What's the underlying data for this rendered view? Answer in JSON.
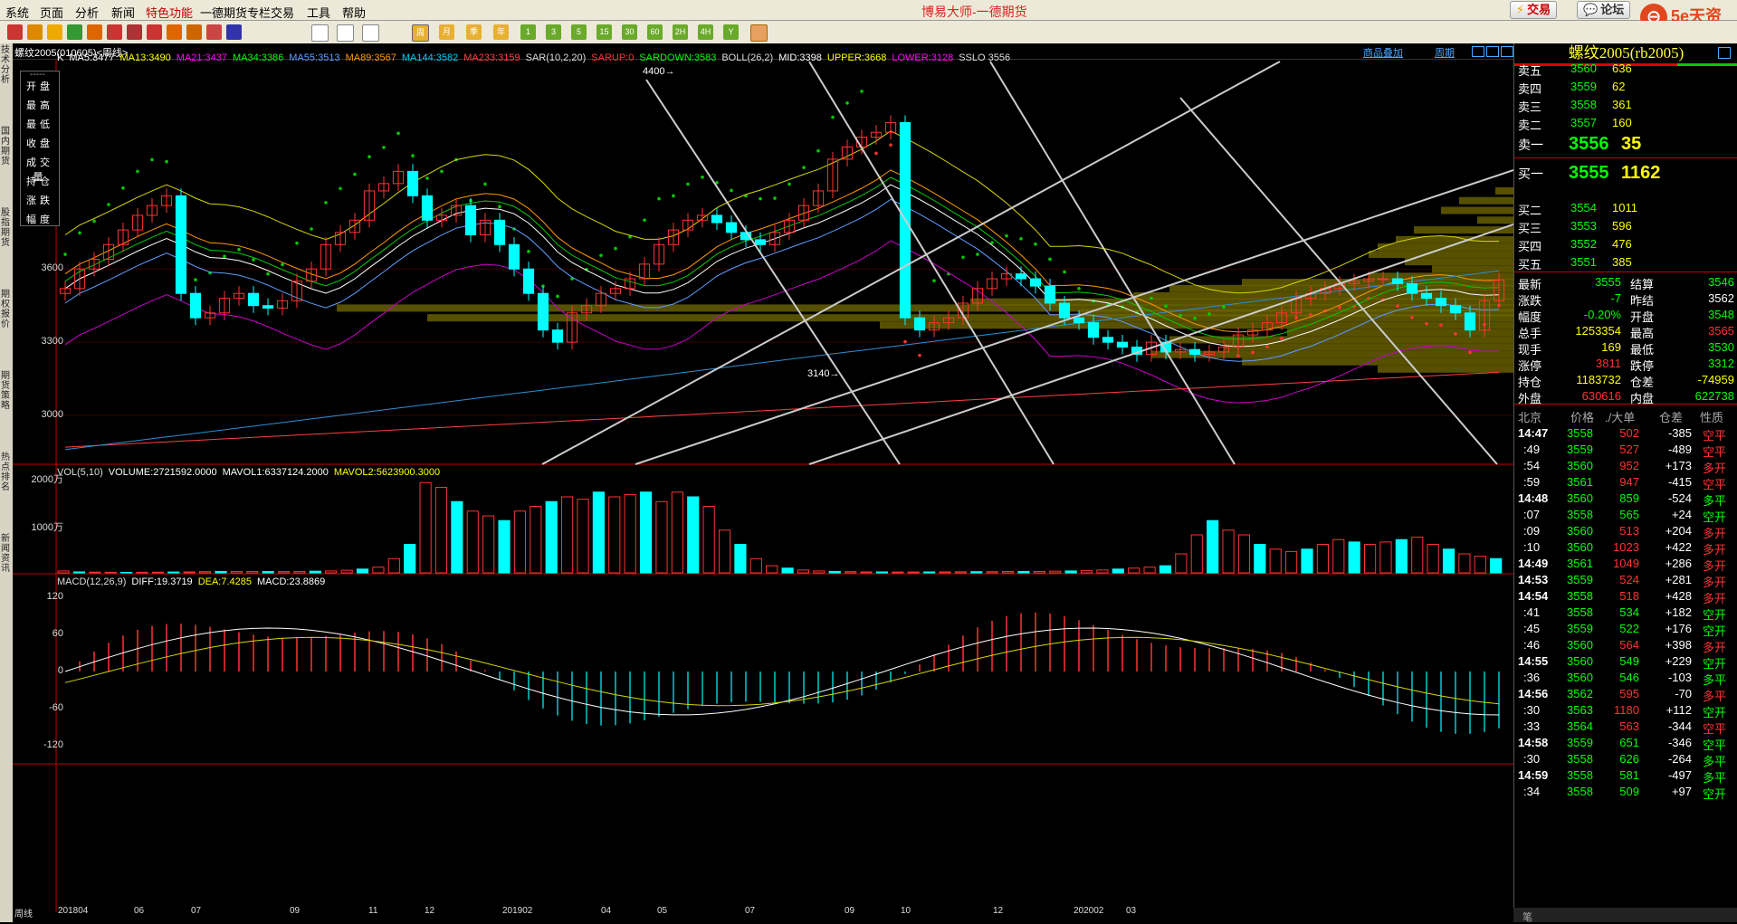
{
  "menu": {
    "items": [
      {
        "label": "系统",
        "red": false
      },
      {
        "label": "页面",
        "red": false
      },
      {
        "label": "分析",
        "red": false
      },
      {
        "label": "新闻",
        "red": false
      },
      {
        "label": "特色功能",
        "red": true
      },
      {
        "label": "一德期货专栏",
        "red": false
      },
      {
        "label": "交易",
        "red": false
      },
      {
        "label": "工具",
        "red": false
      },
      {
        "label": "帮助",
        "red": false
      }
    ],
    "app_title": "博易大师-一德期货",
    "trade_button": "交易",
    "forum_button": "论坛",
    "logo_text": "5e天资",
    "logo_url": "setz.com"
  },
  "toolbar": {
    "period_buttons": [
      "1",
      "3",
      "5",
      "15",
      "30",
      "60",
      "2H",
      "4H",
      "Y"
    ]
  },
  "left_tabs": [
    "技术分析",
    "国内期货",
    "股指期货",
    "期权报价",
    "期货策略",
    "热点排名",
    "新闻资讯"
  ],
  "chart": {
    "tab_name": "螺纹2005(010605)<周线>",
    "right_tabs": [
      "商品叠加",
      "周期"
    ],
    "main_legend": [
      {
        "text": "K",
        "color": "#ffffff"
      },
      {
        "text": "MA5:3477",
        "color": "#ffffff"
      },
      {
        "text": "MA13:3490",
        "color": "#ffff00"
      },
      {
        "text": "MA21:3437",
        "color": "#ff00ff"
      },
      {
        "text": "MA34:3386",
        "color": "#00ff00"
      },
      {
        "text": "MA55:3513",
        "color": "#5f9fff"
      },
      {
        "text": "MA89:3567",
        "color": "#ff9900"
      },
      {
        "text": "MA144:3582",
        "color": "#00ccff"
      },
      {
        "text": "MA233:3159",
        "color": "#ff4040"
      },
      {
        "text": "SAR(10,2,20)",
        "color": "#dddddd"
      },
      {
        "text": "SARUP:0",
        "color": "#ff3333"
      },
      {
        "text": "SARDOWN:3583",
        "color": "#00ff00"
      },
      {
        "text": "BOLL(26,2)",
        "color": "#dddddd"
      },
      {
        "text": "MID:3398",
        "color": "#ffffff"
      },
      {
        "text": "UPPER:3668",
        "color": "#ffff00"
      },
      {
        "text": "LOWER:3128",
        "color": "#ff00ff"
      },
      {
        "text": "SSLO 3556",
        "color": "#dddddd"
      }
    ],
    "vol_legend": [
      {
        "text": "VOL(5,10)",
        "color": "#dddddd"
      },
      {
        "text": "VOLUME:2721592.0000",
        "color": "#ffffff"
      },
      {
        "text": "MAVOL1:6337124.2000",
        "color": "#ffffff"
      },
      {
        "text": "MAVOL2:5623900.3000",
        "color": "#ffff00"
      }
    ],
    "macd_legend": [
      {
        "text": "MACD(12,26,9)",
        "color": "#dddddd"
      },
      {
        "text": "DIFF:19.3719",
        "color": "#ffffff"
      },
      {
        "text": "DEA:7.4285",
        "color": "#ffff00"
      },
      {
        "text": "MACD:23.8869",
        "color": "#ffffff"
      }
    ],
    "price_ticks": [
      "3600",
      "3300",
      "3000"
    ],
    "vol_ticks": [
      "2000万",
      "1000万"
    ],
    "macd_ticks": [
      "120",
      "60",
      "0",
      "-60",
      "-120"
    ],
    "x_ticks": [
      "周线",
      "201804",
      "06",
      "07",
      "09",
      "11",
      "12",
      "201902",
      "04",
      "05",
      "07",
      "09",
      "10",
      "12",
      "202002",
      "03"
    ],
    "high_label": "4400",
    "low_label": "3140"
  },
  "chart_data": {
    "type": "candlestick",
    "title": "螺纹2005(010605)<周线>",
    "ylim": [
      2800,
      4450
    ],
    "highest": 4400,
    "lowest": 3140,
    "x_axis_labels": [
      "201804",
      "06",
      "07",
      "09",
      "11",
      "12",
      "201902",
      "04",
      "05",
      "07",
      "09",
      "10",
      "12",
      "202002",
      "03"
    ],
    "close": [
      3520,
      3600,
      3640,
      3700,
      3760,
      3820,
      3860,
      3900,
      3500,
      3400,
      3420,
      3480,
      3500,
      3450,
      3440,
      3470,
      3550,
      3600,
      3700,
      3750,
      3800,
      3920,
      3950,
      4000,
      3900,
      3800,
      3820,
      3860,
      3740,
      3800,
      3700,
      3600,
      3500,
      3350,
      3300,
      3420,
      3450,
      3500,
      3520,
      3560,
      3620,
      3700,
      3760,
      3800,
      3820,
      3790,
      3750,
      3720,
      3700,
      3750,
      3800,
      3860,
      3920,
      4050,
      4100,
      4140,
      4160,
      4200,
      3400,
      3350,
      3380,
      3400,
      3460,
      3520,
      3560,
      3580,
      3560,
      3530,
      3460,
      3400,
      3380,
      3320,
      3300,
      3280,
      3250,
      3300,
      3260,
      3270,
      3250,
      3260,
      3280,
      3330,
      3350,
      3380,
      3420,
      3480,
      3500,
      3520,
      3540,
      3550,
      3560,
      3560,
      3540,
      3500,
      3480,
      3450,
      3420,
      3350,
      3470,
      3555
    ],
    "volume_wan": [
      40,
      20,
      15,
      12,
      10,
      12,
      14,
      18,
      20,
      25,
      30,
      30,
      30,
      28,
      26,
      30,
      35,
      40,
      55,
      80,
      120,
      300,
      600,
      1900,
      1800,
      1500,
      1300,
      1200,
      1100,
      1300,
      1400,
      1500,
      1600,
      1550,
      1700,
      1600,
      1650,
      1700,
      1500,
      1700,
      1600,
      1400,
      900,
      600,
      300,
      150,
      100,
      60,
      40,
      30,
      25,
      20,
      20,
      18,
      18,
      20,
      20,
      22,
      25,
      25,
      28,
      30,
      30,
      35,
      40,
      50,
      60,
      80,
      100,
      120,
      150,
      400,
      800,
      1100,
      900,
      800,
      600,
      500,
      450,
      500,
      600,
      700,
      650,
      600,
      650,
      700,
      750,
      600,
      500,
      400,
      350,
      300
    ],
    "macd_hist_range": [
      -140,
      130
    ],
    "vol_ylim": [
      0,
      2000
    ],
    "macd_ylim": [
      -140,
      140
    ]
  },
  "quote": {
    "title": "螺纹2005(rb2005)",
    "asks": [
      {
        "label": "卖五",
        "price": "3560",
        "vol": "636"
      },
      {
        "label": "卖四",
        "price": "3559",
        "vol": "62"
      },
      {
        "label": "卖三",
        "price": "3558",
        "vol": "361"
      },
      {
        "label": "卖二",
        "price": "3557",
        "vol": "160"
      },
      {
        "label": "卖一",
        "price": "3556",
        "vol": "35"
      }
    ],
    "bids": [
      {
        "label": "买一",
        "price": "3555",
        "vol": "1162"
      },
      {
        "label": "买二",
        "price": "3554",
        "vol": "1011"
      },
      {
        "label": "买三",
        "price": "3553",
        "vol": "596"
      },
      {
        "label": "买四",
        "price": "3552",
        "vol": "476"
      },
      {
        "label": "买五",
        "price": "3551",
        "vol": "385"
      }
    ],
    "stats": [
      {
        "l1": "最新",
        "v1": "3555",
        "c1": "#00ff00",
        "l2": "结算",
        "v2": "3546",
        "c2": "#00ff00"
      },
      {
        "l1": "涨跌",
        "v1": "-7",
        "c1": "#00ff00",
        "l2": "昨结",
        "v2": "3562",
        "c2": "#ffffff"
      },
      {
        "l1": "幅度",
        "v1": "-0.20%",
        "c1": "#00ff00",
        "l2": "开盘",
        "v2": "3548",
        "c2": "#00ff00"
      },
      {
        "l1": "总手",
        "v1": "1253354",
        "c1": "#ffff00",
        "l2": "最高",
        "v2": "3565",
        "c2": "#ff3333"
      },
      {
        "l1": "现手",
        "v1": "169",
        "c1": "#ffff00",
        "l2": "最低",
        "v2": "3530",
        "c2": "#00ff00"
      },
      {
        "l1": "涨停",
        "v1": "3811",
        "c1": "#ff3333",
        "l2": "跌停",
        "v2": "3312",
        "c2": "#00ff00"
      },
      {
        "l1": "持仓",
        "v1": "1183732",
        "c1": "#ffff00",
        "l2": "仓差",
        "v2": "-74959",
        "c2": "#ffff00"
      },
      {
        "l1": "外盘",
        "v1": "630616",
        "c1": "#ff3333",
        "l2": "内盘",
        "v2": "622738",
        "c2": "#00ff00"
      }
    ],
    "tick_header": {
      "time": "北京",
      "price": "价格",
      "vol": "./大单",
      "oi": "仓差",
      "nature": "性质"
    },
    "ticks": [
      {
        "time": "14:47",
        "price": "3558",
        "vol": "502",
        "oi": "-385",
        "nature": "空平",
        "vc": "#ff3333",
        "nc": "#ff3333"
      },
      {
        "time": ":49",
        "price": "3559",
        "vol": "527",
        "oi": "-489",
        "nature": "空平",
        "vc": "#ff3333",
        "nc": "#ff3333"
      },
      {
        "time": ":54",
        "price": "3560",
        "vol": "952",
        "oi": "+173",
        "nature": "多开",
        "vc": "#ff3333",
        "nc": "#ff3333"
      },
      {
        "time": ":59",
        "price": "3561",
        "vol": "947",
        "oi": "-415",
        "nature": "空平",
        "vc": "#ff3333",
        "nc": "#ff3333"
      },
      {
        "time": "14:48",
        "price": "3560",
        "vol": "859",
        "oi": "-524",
        "nature": "多平",
        "vc": "#00ff00",
        "nc": "#00ff00"
      },
      {
        "time": ":07",
        "price": "3558",
        "vol": "565",
        "oi": "+24",
        "nature": "空开",
        "vc": "#00ff00",
        "nc": "#00ff00"
      },
      {
        "time": ":09",
        "price": "3560",
        "vol": "513",
        "oi": "+204",
        "nature": "多开",
        "vc": "#ff3333",
        "nc": "#ff3333"
      },
      {
        "time": ":10",
        "price": "3560",
        "vol": "1023",
        "oi": "+422",
        "nature": "多开",
        "vc": "#ff3333",
        "nc": "#ff3333"
      },
      {
        "time": "14:49",
        "price": "3561",
        "vol": "1049",
        "oi": "+286",
        "nature": "多开",
        "vc": "#ff3333",
        "nc": "#ff3333"
      },
      {
        "time": "14:53",
        "price": "3559",
        "vol": "524",
        "oi": "+281",
        "nature": "多开",
        "vc": "#ff3333",
        "nc": "#ff3333"
      },
      {
        "time": "14:54",
        "price": "3558",
        "vol": "518",
        "oi": "+428",
        "nature": "多开",
        "vc": "#ff3333",
        "nc": "#ff3333"
      },
      {
        "time": ":41",
        "price": "3558",
        "vol": "534",
        "oi": "+182",
        "nature": "空开",
        "vc": "#00ff00",
        "nc": "#00ff00"
      },
      {
        "time": ":45",
        "price": "3559",
        "vol": "522",
        "oi": "+176",
        "nature": "空开",
        "vc": "#00ff00",
        "nc": "#00ff00"
      },
      {
        "time": ":46",
        "price": "3560",
        "vol": "564",
        "oi": "+398",
        "nature": "多开",
        "vc": "#ff3333",
        "nc": "#ff3333"
      },
      {
        "time": "14:55",
        "price": "3560",
        "vol": "549",
        "oi": "+229",
        "nature": "空开",
        "vc": "#00ff00",
        "nc": "#00ff00"
      },
      {
        "time": ":36",
        "price": "3560",
        "vol": "546",
        "oi": "-103",
        "nature": "多平",
        "vc": "#00ff00",
        "nc": "#00ff00"
      },
      {
        "time": "14:56",
        "price": "3562",
        "vol": "595",
        "oi": "-70",
        "nature": "多平",
        "vc": "#ff3333",
        "nc": "#ff3333"
      },
      {
        "time": ":30",
        "price": "3563",
        "vol": "1180",
        "oi": "+112",
        "nature": "空开",
        "vc": "#ff3333",
        "nc": "#00ff00"
      },
      {
        "time": ":33",
        "price": "3564",
        "vol": "563",
        "oi": "-344",
        "nature": "空平",
        "vc": "#ff3333",
        "nc": "#ff3333"
      },
      {
        "time": "14:58",
        "price": "3559",
        "vol": "651",
        "oi": "-346",
        "nature": "空平",
        "vc": "#00ff00",
        "nc": "#00ff00"
      },
      {
        "time": ":30",
        "price": "3558",
        "vol": "626",
        "oi": "-264",
        "nature": "多平",
        "vc": "#00ff00",
        "nc": "#00ff00"
      },
      {
        "time": "14:59",
        "price": "3558",
        "vol": "581",
        "oi": "-497",
        "nature": "多平",
        "vc": "#00ff00",
        "nc": "#00ff00"
      },
      {
        "time": ":34",
        "price": "3558",
        "vol": "509",
        "oi": "+97",
        "nature": "空开",
        "vc": "#00ff00",
        "nc": "#00ff00"
      }
    ],
    "bottom_tab": "笔"
  },
  "chip_panel": {
    "cells": [
      "开盘",
      "最高",
      "最低",
      "收盘",
      "成交量",
      "持仓",
      "涨跌",
      "幅度"
    ]
  }
}
